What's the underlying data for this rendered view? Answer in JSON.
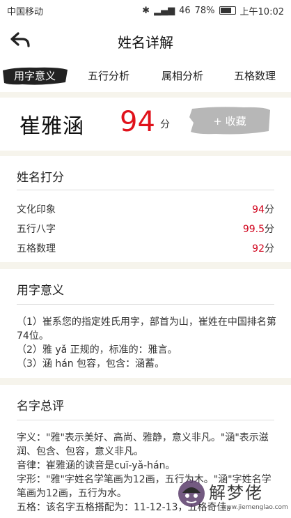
{
  "status": {
    "carrier": "中国移动",
    "signal": "46",
    "battery": "78%",
    "time": "上午10:02",
    "battery_fraction": 0.78
  },
  "header": {
    "title": "姓名详解"
  },
  "tabs": [
    {
      "label": "用字意义"
    },
    {
      "label": "五行分析"
    },
    {
      "label": "属相分析"
    },
    {
      "label": "五格数理"
    }
  ],
  "name_card": {
    "name": "崔雅涵",
    "score": "94",
    "score_unit": "分",
    "favorite_label": "+ 收藏"
  },
  "scores": {
    "title": "姓名打分",
    "rows": [
      {
        "label": "文化印象",
        "value": "94",
        "unit": "分"
      },
      {
        "label": "五行八字",
        "value": "99.5",
        "unit": "分"
      },
      {
        "label": "五格数理",
        "value": "92",
        "unit": "分"
      }
    ]
  },
  "meaning": {
    "title": "用字意义",
    "lines": [
      "（1）崔系您的指定姓氏用字，部首为山，崔姓在中国排名第74位。",
      "（2）雅 yǎ 正规的，标准的：雅言。",
      "（3）涵 hán 包容，包含：涵蓄。"
    ]
  },
  "summary": {
    "title": "名字总评",
    "lines": [
      "字义：\"雅\"表示美好、高尚、雅静，意义非凡。\"涵\"表示滋润、包含、包容，意义非凡。",
      "音律：崔雅涵的读音是cuī-yǎ-hán。",
      "字形：\"雅\"字姓名学笔画为12画，五行为木。\"涵\"字姓名学笔画为12画，五行为水。",
      "五格：该名字五格搭配为：11-12-13，五格奇佳。"
    ]
  },
  "watermark": {
    "text": "解梦佬",
    "url": "www.jiemenglao.com"
  }
}
